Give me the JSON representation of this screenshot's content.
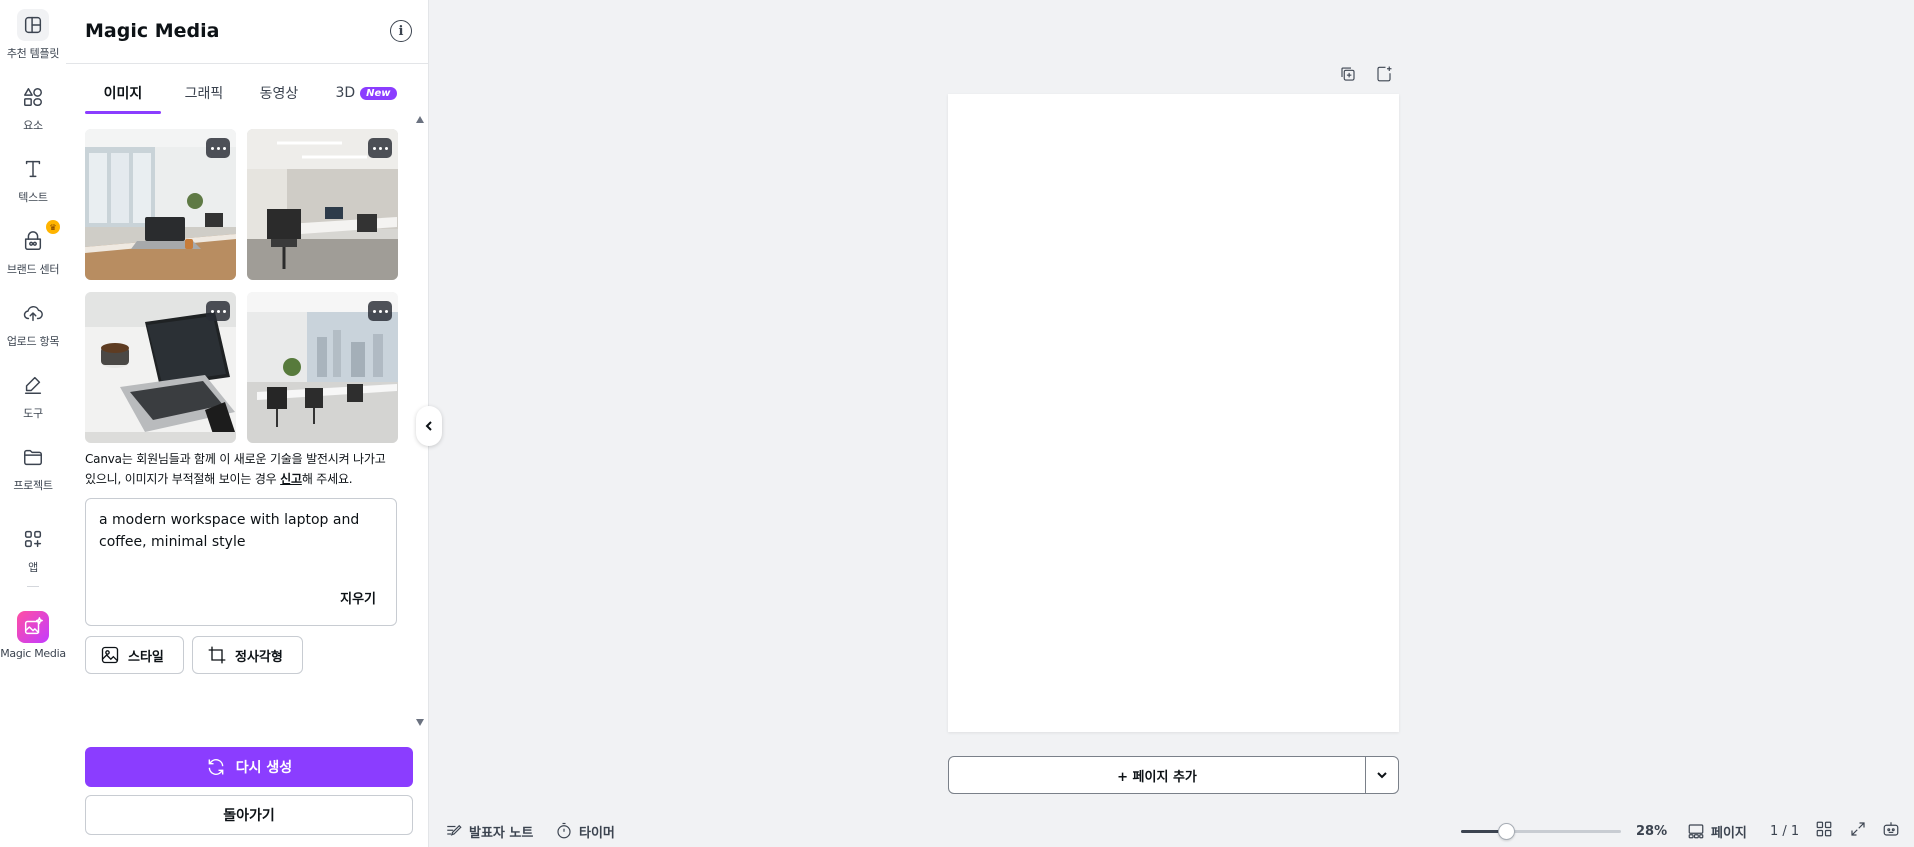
{
  "colors": {
    "accent": "#8b3dff",
    "canvas_bg": "#f1f2f4",
    "panel_bg": "#ffffff"
  },
  "rail": {
    "items": [
      {
        "label": "추천 템플릿",
        "icon": "template-icon"
      },
      {
        "label": "요소",
        "icon": "elements-icon"
      },
      {
        "label": "텍스트",
        "icon": "text-icon"
      },
      {
        "label": "브랜드 센터",
        "icon": "brand-icon",
        "badge": "crown-icon"
      },
      {
        "label": "업로드 항목",
        "icon": "upload-cloud-icon"
      },
      {
        "label": "도구",
        "icon": "draw-tool-icon"
      },
      {
        "label": "프로젝트",
        "icon": "folder-icon"
      },
      {
        "label": "앱",
        "icon": "apps-icon"
      },
      {
        "label": "Magic Media",
        "icon": "magic-media-icon"
      }
    ]
  },
  "panel": {
    "title": "Magic Media",
    "info_icon": "info-icon",
    "tabs": [
      {
        "label": "이미지",
        "active": true
      },
      {
        "label": "그래픽"
      },
      {
        "label": "동영상"
      },
      {
        "label": "3D",
        "badge": "New"
      }
    ],
    "thumbnails": [
      {
        "subject": "office-window-laptop"
      },
      {
        "subject": "office-chairs-desk"
      },
      {
        "subject": "laptop-coffee-phone"
      },
      {
        "subject": "office-city-view"
      }
    ],
    "disclaimer": {
      "text_before": "Canva는 회원님들과 함께 이 새로운 기술을 발전시켜 나가고 있으니, 이미지가 부적절해 보이는 경우 ",
      "link": "신고",
      "text_after": "해 주세요."
    },
    "prompt": {
      "value": "a modern workspace with laptop and coffee, minimal style",
      "clear_label": "지우기"
    },
    "style_label": "스타일",
    "aspect_label": "정사각형",
    "regenerate_label": "다시 생성",
    "back_label": "돌아가기"
  },
  "canvas": {
    "add_page_label": "+ 페이지 추가"
  },
  "bottom_bar": {
    "notes_label": "발표자 노트",
    "timer_label": "타이머",
    "zoom": "28%",
    "zoom_fraction": 0.28,
    "pages_label": "페이지",
    "page_count": "1 / 1"
  }
}
